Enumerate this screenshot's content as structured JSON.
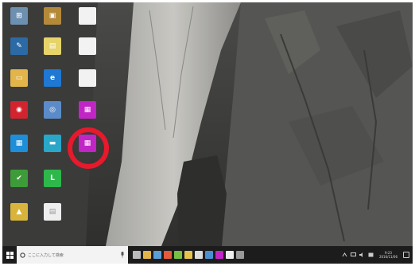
{
  "desktop": {
    "icons": [
      {
        "name": "Windows",
        "label": "",
        "color": "#6d8fb0",
        "glyph": "⊞"
      },
      {
        "name": "Photo",
        "label": "",
        "color": "#b48a3a",
        "glyph": "▣"
      },
      {
        "name": "Document",
        "label": "",
        "color": "#f2f2f2",
        "glyph": ""
      },
      {
        "name": "Tool",
        "label": "",
        "color": "#2b6aa5",
        "glyph": "✎"
      },
      {
        "name": "Notepad",
        "label": "",
        "color": "#e6d36a",
        "glyph": "▤"
      },
      {
        "name": "Document",
        "label": "",
        "color": "#f2f2f2",
        "glyph": ""
      },
      {
        "name": "Folder",
        "label": "",
        "color": "#e2b54a",
        "glyph": "▭"
      },
      {
        "name": "Internet Explorer",
        "label": "",
        "color": "#1f78d1",
        "glyph": "e"
      },
      {
        "name": "Document",
        "label": "",
        "color": "#f2f2f2",
        "glyph": ""
      },
      {
        "name": "Security",
        "label": "",
        "color": "#d3232f",
        "glyph": "◉"
      },
      {
        "name": "Application",
        "label": "",
        "color": "#5b8cc9",
        "glyph": "◎"
      },
      {
        "name": "Purple App",
        "label": "",
        "color": "#c225c6",
        "glyph": "▦"
      },
      {
        "name": "Network",
        "label": "",
        "color": "#1e8ed8",
        "glyph": "▦"
      },
      {
        "name": "Application",
        "label": "",
        "color": "#2aa6c9",
        "glyph": "▬"
      },
      {
        "name": "Purple App",
        "label": "",
        "color": "#c225c6",
        "glyph": "▦"
      },
      {
        "name": "Tool",
        "label": "",
        "color": "#3e9b3a",
        "glyph": "✔"
      },
      {
        "name": "LINE",
        "label": "",
        "color": "#2eb84b",
        "glyph": "L"
      },
      {
        "name": "Document",
        "label": "",
        "color": "#d9b43c",
        "glyph": "▲"
      },
      {
        "name": "Document",
        "label": "",
        "color": "#eeeeee",
        "glyph": "▤"
      }
    ]
  },
  "taskbar": {
    "search_placeholder": "ここに入力して検索",
    "clock_time": "9:23",
    "clock_date": "2016/11/06",
    "task_icons": [
      {
        "name": "task-view",
        "color": "#bbbbbb"
      },
      {
        "name": "file-explorer",
        "color": "#e2b54a"
      },
      {
        "name": "store",
        "color": "#5a9fd6"
      },
      {
        "name": "chrome",
        "color": "#e45a3a"
      },
      {
        "name": "app-green",
        "color": "#77c043"
      },
      {
        "name": "app-yellow",
        "color": "#e5c44e"
      },
      {
        "name": "app-white",
        "color": "#dddddd"
      },
      {
        "name": "app-blue",
        "color": "#4a8fd0"
      },
      {
        "name": "app-purple",
        "color": "#c225c6"
      },
      {
        "name": "app-doc",
        "color": "#eeeeee"
      },
      {
        "name": "app-tools",
        "color": "#999999"
      }
    ]
  }
}
